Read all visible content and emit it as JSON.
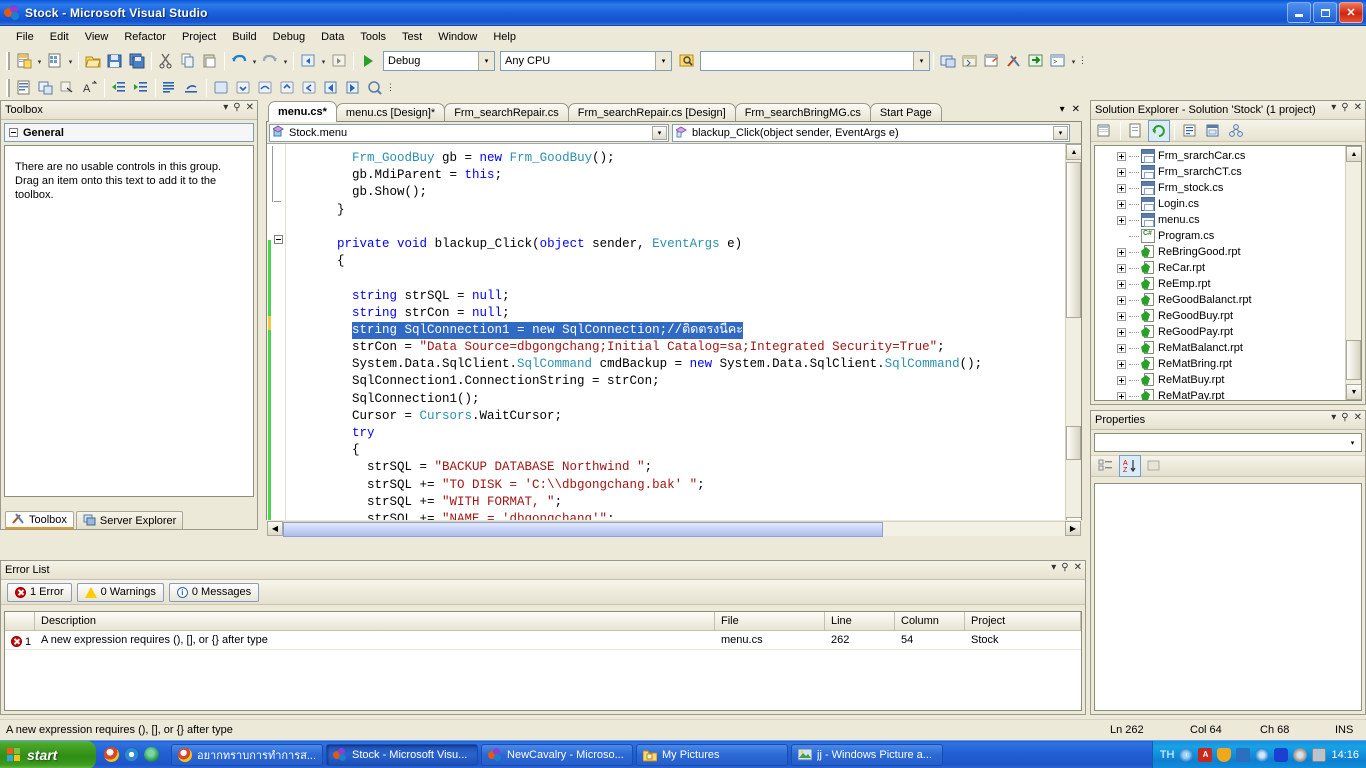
{
  "window": {
    "title": "Stock - Microsoft Visual Studio",
    "app_icon": "visual-studio-icon",
    "minimize": "_",
    "maximize": "□",
    "close": "✕"
  },
  "menubar": {
    "items": [
      "File",
      "Edit",
      "View",
      "Refactor",
      "Project",
      "Build",
      "Debug",
      "Data",
      "Tools",
      "Test",
      "Window",
      "Help"
    ]
  },
  "toolbar": {
    "configuration": "Debug",
    "platform": "Any CPU",
    "find_value": "",
    "row1_icons": [
      "new-project-icon",
      "add-new-item-icon",
      "open-file-icon",
      "save-icon",
      "save-all-icon",
      "cut-icon",
      "copy-icon",
      "paste-icon",
      "undo-icon",
      "redo-icon",
      "navigate-backward-icon",
      "navigate-forward-icon",
      "start-debugging-icon",
      "solution-configurations-combo",
      "solution-platforms-combo",
      "find-in-files-icon",
      "find-combo"
    ],
    "row2_icons": [
      "toggle-all-outlining-icon",
      "comment-selection-icon",
      "uncomment-selection-icon",
      "display-letters-icon",
      "decrease-indent-icon",
      "increase-indent-icon",
      "bookmark-icon",
      "clear-bookmarks-icon",
      "toggle-breakpoint-icon",
      "step-into-icon",
      "step-over-icon",
      "step-out-icon",
      "step-back-icon",
      "previous-bookmark-icon",
      "next-bookmark-icon",
      "quickwatch-icon"
    ],
    "right_icons": [
      "object-browser-icon",
      "toolbox-icon",
      "properties-window-icon",
      "tools-icon",
      "solution-explorer-icon",
      "command-window-icon"
    ]
  },
  "toolbox": {
    "title": "Toolbox",
    "group_label": "General",
    "empty_message": "There are no usable controls in this group. Drag an item onto this text to add it to the toolbox.",
    "dock_tabs": [
      {
        "label": "Toolbox",
        "icon": "toolbox-icon",
        "active": true
      },
      {
        "label": "Server Explorer",
        "icon": "server-explorer-icon",
        "active": false
      }
    ],
    "header_buttons": [
      "window-position-icon",
      "auto-hide-pin-icon",
      "close-icon"
    ]
  },
  "editor": {
    "tabs": [
      {
        "label": "menu.cs*",
        "active": true
      },
      {
        "label": "menu.cs [Design]*",
        "active": false
      },
      {
        "label": "Frm_searchRepair.cs",
        "active": false
      },
      {
        "label": "Frm_searchRepair.cs [Design]",
        "active": false
      },
      {
        "label": "Frm_searchBringMG.cs",
        "active": false
      },
      {
        "label": "Start Page",
        "active": false
      }
    ],
    "tab_buttons": [
      "tab-list-dropdown-icon",
      "close-tab-icon"
    ],
    "class_combo": "Stock.menu",
    "class_combo_icon": "class-icon",
    "member_combo": "blackup_Click(object sender, EventArgs e)",
    "member_combo_icon": "method-icon",
    "code_lines": [
      {
        "indent": 8,
        "tokens": [
          {
            "t": "Frm_GoodBuy",
            "c": "ty"
          },
          {
            "t": " gb = ",
            "c": ""
          },
          {
            "t": "new",
            "c": "kw"
          },
          {
            "t": " ",
            "c": ""
          },
          {
            "t": "Frm_GoodBuy",
            "c": "ty"
          },
          {
            "t": "();",
            "c": ""
          }
        ]
      },
      {
        "indent": 8,
        "tokens": [
          {
            "t": "gb.MdiParent = ",
            "c": ""
          },
          {
            "t": "this",
            "c": "kw"
          },
          {
            "t": ";",
            "c": ""
          }
        ]
      },
      {
        "indent": 8,
        "tokens": [
          {
            "t": "gb.Show();",
            "c": ""
          }
        ]
      },
      {
        "indent": 6,
        "tokens": [
          {
            "t": "}",
            "c": ""
          }
        ]
      },
      {
        "indent": 0,
        "tokens": []
      },
      {
        "indent": 6,
        "tokens": [
          {
            "t": "private",
            "c": "kw"
          },
          {
            "t": " ",
            "c": ""
          },
          {
            "t": "void",
            "c": "kw"
          },
          {
            "t": " blackup_Click(",
            "c": ""
          },
          {
            "t": "object",
            "c": "kw"
          },
          {
            "t": " sender, ",
            "c": ""
          },
          {
            "t": "EventArgs",
            "c": "ty"
          },
          {
            "t": " e)",
            "c": ""
          }
        ]
      },
      {
        "indent": 6,
        "tokens": [
          {
            "t": "{",
            "c": ""
          }
        ]
      },
      {
        "indent": 0,
        "tokens": []
      },
      {
        "indent": 8,
        "tokens": [
          {
            "t": "string",
            "c": "kw"
          },
          {
            "t": " strSQL = ",
            "c": ""
          },
          {
            "t": "null",
            "c": "kw"
          },
          {
            "t": ";",
            "c": ""
          }
        ]
      },
      {
        "indent": 8,
        "tokens": [
          {
            "t": "string",
            "c": "kw"
          },
          {
            "t": " strCon = ",
            "c": ""
          },
          {
            "t": "null",
            "c": "kw"
          },
          {
            "t": ";",
            "c": ""
          }
        ]
      },
      {
        "indent": 8,
        "selected": true,
        "tokens": [
          {
            "t": "string",
            "c": "kw"
          },
          {
            "t": " SqlConnection1 = ",
            "c": ""
          },
          {
            "t": "new",
            "c": "kw"
          },
          {
            "t": " SqlConnection;",
            "c": ""
          },
          {
            "t": "//ติดตรงนี้คะ",
            "c": "cm"
          }
        ]
      },
      {
        "indent": 8,
        "tokens": [
          {
            "t": "strCon = ",
            "c": ""
          },
          {
            "t": "\"Data Source=dbgongchang;Initial Catalog=sa;Integrated Security=True\"",
            "c": "st"
          },
          {
            "t": ";",
            "c": ""
          }
        ]
      },
      {
        "indent": 8,
        "tokens": [
          {
            "t": "System.Data.SqlClient.",
            "c": ""
          },
          {
            "t": "SqlCommand",
            "c": "ty"
          },
          {
            "t": " cmdBackup = ",
            "c": ""
          },
          {
            "t": "new",
            "c": "kw"
          },
          {
            "t": " System.Data.SqlClient.",
            "c": ""
          },
          {
            "t": "SqlCommand",
            "c": "ty"
          },
          {
            "t": "();",
            "c": ""
          }
        ]
      },
      {
        "indent": 8,
        "tokens": [
          {
            "t": "SqlConnection1.ConnectionString = strCon;",
            "c": ""
          }
        ]
      },
      {
        "indent": 8,
        "tokens": [
          {
            "t": "SqlConnection1();",
            "c": ""
          }
        ]
      },
      {
        "indent": 8,
        "tokens": [
          {
            "t": "Cursor = ",
            "c": ""
          },
          {
            "t": "Cursors",
            "c": "ty"
          },
          {
            "t": ".WaitCursor;",
            "c": ""
          }
        ]
      },
      {
        "indent": 8,
        "tokens": [
          {
            "t": "try",
            "c": "kw"
          }
        ]
      },
      {
        "indent": 8,
        "tokens": [
          {
            "t": "{",
            "c": ""
          }
        ]
      },
      {
        "indent": 10,
        "tokens": [
          {
            "t": "strSQL = ",
            "c": ""
          },
          {
            "t": "\"BACKUP DATABASE Northwind \"",
            "c": "st"
          },
          {
            "t": ";",
            "c": ""
          }
        ]
      },
      {
        "indent": 10,
        "tokens": [
          {
            "t": "strSQL += ",
            "c": ""
          },
          {
            "t": "\"TO DISK = 'C:\\\\dbgongchang.bak' \"",
            "c": "st"
          },
          {
            "t": ";",
            "c": ""
          }
        ]
      },
      {
        "indent": 10,
        "tokens": [
          {
            "t": "strSQL += ",
            "c": ""
          },
          {
            "t": "\"WITH FORMAT, \"",
            "c": "st"
          },
          {
            "t": ";",
            "c": ""
          }
        ]
      },
      {
        "indent": 10,
        "tokens": [
          {
            "t": "strSQL += ",
            "c": ""
          },
          {
            "t": "\"NAME = 'dbgongchang'\"",
            "c": "st"
          },
          {
            "t": ";",
            "c": ""
          }
        ]
      }
    ]
  },
  "solution_explorer": {
    "title": "Solution Explorer - Solution 'Stock' (1 project)",
    "header_buttons": [
      "window-position-icon",
      "auto-hide-pin-icon",
      "close-icon"
    ],
    "toolbar_icons": [
      "properties-icon",
      "show-all-files-icon",
      "refresh-icon",
      "view-code-icon",
      "view-designer-icon",
      "class-view-icon"
    ],
    "items": [
      {
        "label": "Frm_srarchCar.cs",
        "icon": "form-icon",
        "expandable": true
      },
      {
        "label": "Frm_srarchCT.cs",
        "icon": "form-icon",
        "expandable": true
      },
      {
        "label": "Frm_stock.cs",
        "icon": "form-icon",
        "expandable": true
      },
      {
        "label": "Login.cs",
        "icon": "form-icon",
        "expandable": true
      },
      {
        "label": "menu.cs",
        "icon": "form-icon",
        "expandable": true
      },
      {
        "label": "Program.cs",
        "icon": "csharp-file-icon",
        "expandable": false
      },
      {
        "label": "ReBringGood.rpt",
        "icon": "report-icon",
        "expandable": true
      },
      {
        "label": "ReCar.rpt",
        "icon": "report-icon",
        "expandable": true
      },
      {
        "label": "ReEmp.rpt",
        "icon": "report-icon",
        "expandable": true
      },
      {
        "label": "ReGoodBalanct.rpt",
        "icon": "report-icon",
        "expandable": true
      },
      {
        "label": "ReGoodBuy.rpt",
        "icon": "report-icon",
        "expandable": true
      },
      {
        "label": "ReGoodPay.rpt",
        "icon": "report-icon",
        "expandable": true
      },
      {
        "label": "ReMatBalanct.rpt",
        "icon": "report-icon",
        "expandable": true
      },
      {
        "label": "ReMatBring.rpt",
        "icon": "report-icon",
        "expandable": true
      },
      {
        "label": "ReMatBuy.rpt",
        "icon": "report-icon",
        "expandable": true
      },
      {
        "label": "ReMatPay.rpt",
        "icon": "report-icon",
        "expandable": true
      }
    ]
  },
  "properties": {
    "title": "Properties",
    "header_buttons": [
      "window-position-icon",
      "auto-hide-pin-icon",
      "close-icon"
    ],
    "selected_object": "",
    "toolbar_icons": [
      "categorized-icon",
      "alphabetical-icon",
      "property-pages-icon"
    ]
  },
  "error_list": {
    "title": "Error List",
    "header_buttons": [
      "window-position-icon",
      "auto-hide-pin-icon",
      "close-icon"
    ],
    "filters": [
      {
        "label": "1 Error",
        "icon": "error-icon",
        "active": true
      },
      {
        "label": "0 Warnings",
        "icon": "warning-icon",
        "active": false
      },
      {
        "label": "0 Messages",
        "icon": "information-icon",
        "active": false
      }
    ],
    "columns": [
      "",
      "Description",
      "File",
      "Line",
      "Column",
      "Project"
    ],
    "rows": [
      {
        "icon": "error-icon",
        "num": "1",
        "description": "A new expression requires (), [], or {} after type",
        "file": "menu.cs",
        "line": "262",
        "column": "54",
        "project": "Stock"
      }
    ]
  },
  "statusbar": {
    "message": "A new expression requires (), [], or {} after type",
    "ln": "Ln 262",
    "col": "Col 64",
    "ch": "Ch 68",
    "ins": "INS"
  },
  "taskbar": {
    "start_label": "start",
    "quick_launch": [
      "show-desktop-icon",
      "internet-explorer-icon",
      "media-player-icon"
    ],
    "buttons": [
      {
        "label": "อยากทราบการทำการส...",
        "icon": "chrome-icon",
        "active": false
      },
      {
        "label": "Stock - Microsoft Visu...",
        "icon": "visual-studio-icon",
        "active": true
      },
      {
        "label": "NewCavalry - Microso...",
        "icon": "visual-studio-icon",
        "active": false
      },
      {
        "label": "My Pictures",
        "icon": "folder-icon",
        "active": false
      },
      {
        "label": "jj - Windows Picture a...",
        "icon": "picture-viewer-icon",
        "active": false
      }
    ],
    "language": "TH",
    "tray_icons": [
      "show-hidden-icon",
      "pdf-icon",
      "shield-icon",
      "network-icon",
      "volume-icon",
      "bluetooth-icon",
      "antivirus-icon",
      "monitor-icon"
    ],
    "clock": "14:16"
  },
  "colors": {
    "titlebar_blue": "#2C7BEC",
    "chrome_beige": "#ECE9D8",
    "selection_blue": "#316AC5",
    "keyword_blue": "#0000FF",
    "type_teal": "#2B91AF",
    "string_red": "#A31515",
    "comment_green": "#008000",
    "error_red": "#D40000",
    "taskbar_blue": "#2361D4",
    "start_green": "#2F8D16"
  }
}
